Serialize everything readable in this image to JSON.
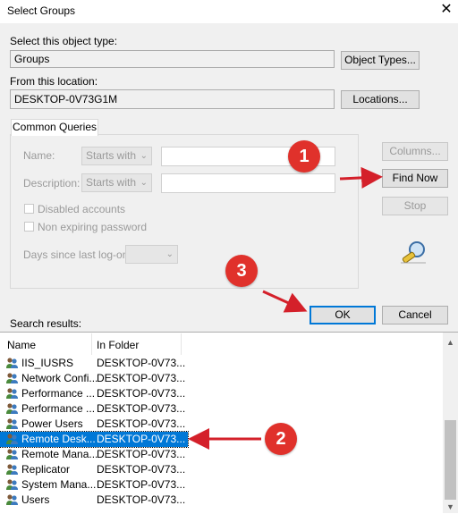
{
  "window": {
    "title": "Select Groups"
  },
  "object_type": {
    "label": "Select this object type:",
    "value": "Groups",
    "button": "Object Types..."
  },
  "location": {
    "label": "From this location:",
    "value": "DESKTOP-0V73G1M",
    "button": "Locations..."
  },
  "common_queries": {
    "tab_label": "Common Queries",
    "name_label": "Name:",
    "name_mode": "Starts with",
    "description_label": "Description:",
    "description_mode": "Starts with",
    "disabled_accounts": "Disabled accounts",
    "non_expiring_password": "Non expiring password",
    "days_label": "Days since last log-on:"
  },
  "side_buttons": {
    "columns": "Columns...",
    "find_now": "Find Now",
    "stop": "Stop"
  },
  "dialog_buttons": {
    "ok": "OK",
    "cancel": "Cancel"
  },
  "search_results": {
    "label": "Search results:",
    "columns": [
      "Name",
      "In Folder"
    ],
    "rows": [
      {
        "name": "IIS_IUSRS",
        "folder": "DESKTOP-0V73..."
      },
      {
        "name": "Network Confi...",
        "folder": "DESKTOP-0V73..."
      },
      {
        "name": "Performance ...",
        "folder": "DESKTOP-0V73..."
      },
      {
        "name": "Performance ...",
        "folder": "DESKTOP-0V73..."
      },
      {
        "name": "Power Users",
        "folder": "DESKTOP-0V73..."
      },
      {
        "name": "Remote Desk...",
        "folder": "DESKTOP-0V73...",
        "selected": true
      },
      {
        "name": "Remote Mana...",
        "folder": "DESKTOP-0V73..."
      },
      {
        "name": "Replicator",
        "folder": "DESKTOP-0V73..."
      },
      {
        "name": "System Mana...",
        "folder": "DESKTOP-0V73..."
      },
      {
        "name": "Users",
        "folder": "DESKTOP-0V73..."
      }
    ]
  },
  "annotations": {
    "badge1": "1",
    "badge2": "2",
    "badge3": "3"
  },
  "colors": {
    "accent": "#0078d7",
    "badge": "#e0312b",
    "arrow": "#d4202a"
  },
  "icons": {
    "close": "close-icon",
    "find": "search-flashlight-icon",
    "group": "users-group-icon",
    "dropdown": "chevron-down-icon"
  }
}
